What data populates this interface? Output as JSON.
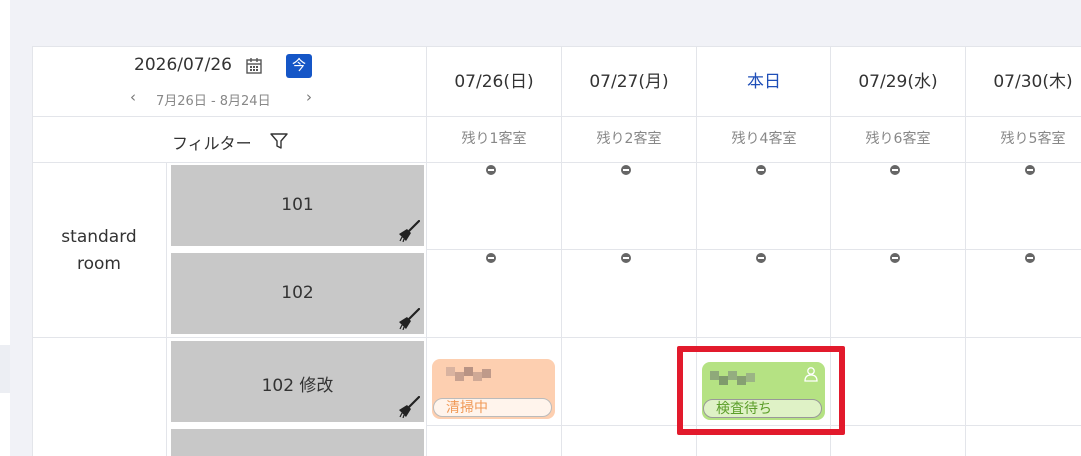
{
  "header": {
    "current_date": "2026/07/26",
    "today_button_label": "今",
    "date_range": "7月26日 - 8月24日",
    "prev_label": "‹",
    "next_label": "›",
    "filter_label": "フィルター"
  },
  "days": [
    {
      "label": "07/26(日)",
      "remaining": "残り1客室",
      "is_today": false
    },
    {
      "label": "07/27(月)",
      "remaining": "残り2客室",
      "is_today": false
    },
    {
      "label": "本日",
      "remaining": "残り4客室",
      "is_today": true
    },
    {
      "label": "07/29(水)",
      "remaining": "残り6客室",
      "is_today": false
    },
    {
      "label": "07/30(木)",
      "remaining": "残り5客室",
      "is_today": false
    }
  ],
  "room_types": [
    {
      "label": "standard room"
    }
  ],
  "rooms": [
    {
      "number": "101",
      "icon": "broom-icon"
    },
    {
      "number": "102",
      "icon": "broom-icon"
    },
    {
      "number": "102 修改",
      "icon": "broom-icon"
    },
    {
      "number": "",
      "icon": ""
    }
  ],
  "bookings": [
    {
      "status": "清掃中",
      "color": "#fdcfb0"
    },
    {
      "status": "検査待ち",
      "color": "#b5e283",
      "icon": "guest-icon"
    }
  ],
  "colors": {
    "accent": "#1556c7",
    "today_text": "#1f4fb8",
    "highlight": "#e21a2c",
    "room_tile": "#c8c8c8"
  }
}
